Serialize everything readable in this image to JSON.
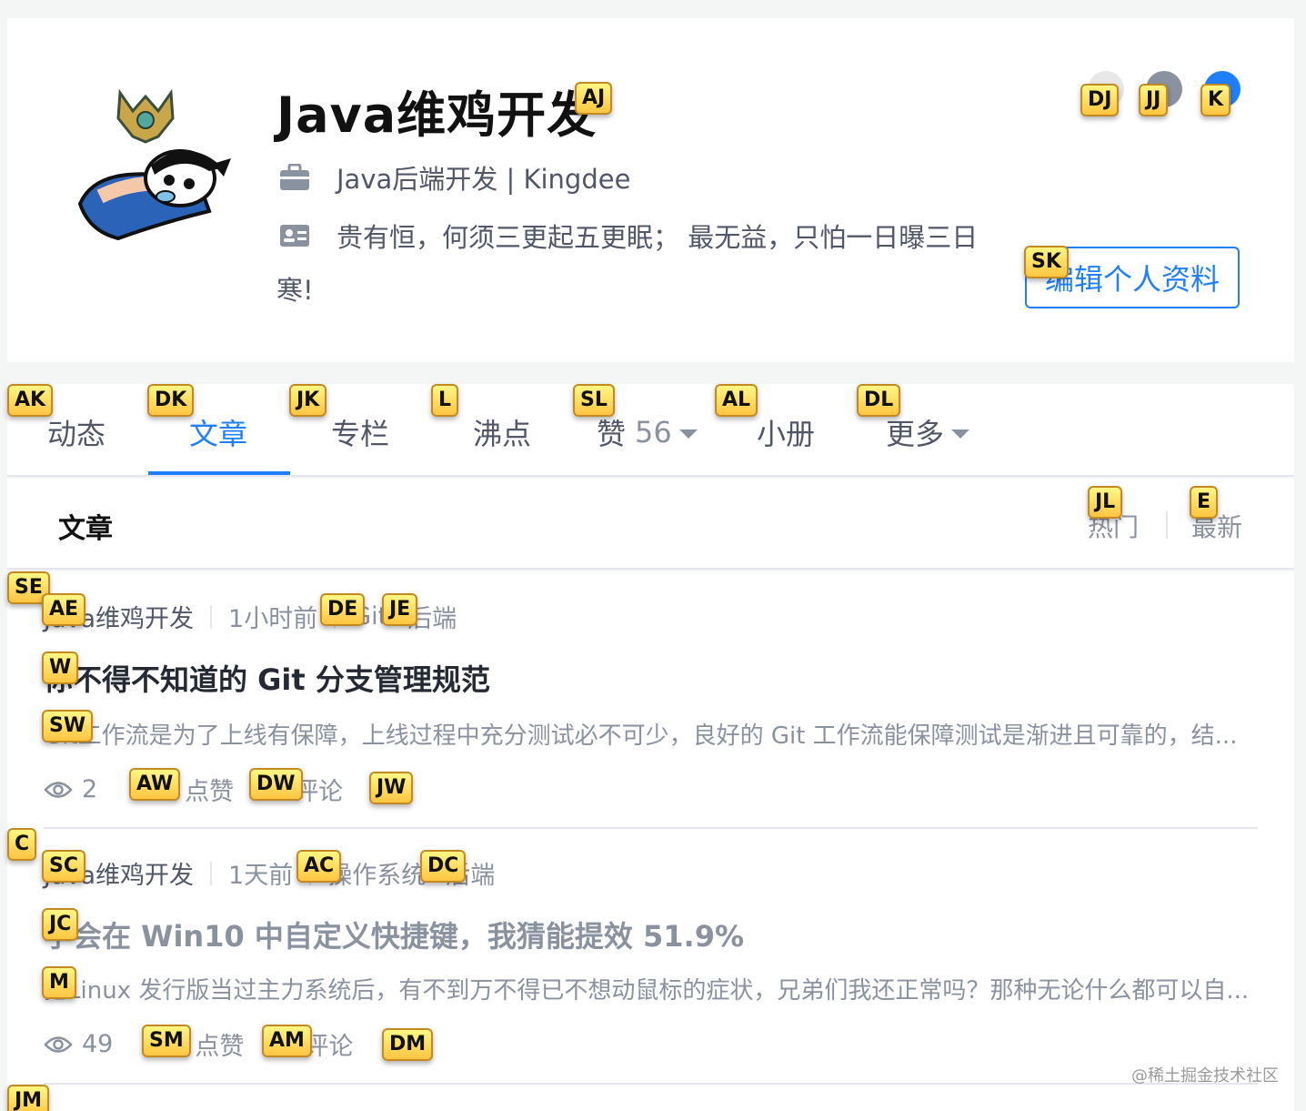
{
  "profile": {
    "name": "Java维鸡开发",
    "job": "Java后端开发 | Kingdee",
    "bio_line1": "贵有恒，何须三更起五更眠； 最无益，只怕一日曝三日",
    "bio_line2": "寒!",
    "edit_button": "编辑个人资料"
  },
  "tabs": [
    {
      "label": "动态"
    },
    {
      "label": "文章"
    },
    {
      "label": "专栏"
    },
    {
      "label": "沸点"
    },
    {
      "label": "赞",
      "count": "56"
    },
    {
      "label": "小册"
    },
    {
      "label": "更多"
    }
  ],
  "section": {
    "title": "文章",
    "sort_hot": "热门",
    "sort_new": "最新"
  },
  "articles": [
    {
      "author": "Java维鸡开发",
      "time": "1小时前",
      "tag1": "Git",
      "tag2": "后端",
      "title": "你不得不知道的 Git 分支管理规范",
      "abstract": "Git工作流是为了上线有保障，上线过程中充分测试必不可少，良好的 Git 工作流能保障测试是渐进且可靠的，结...",
      "views": "2",
      "like": "点赞",
      "comment": "评论"
    },
    {
      "author": "Java维鸡开发",
      "time": "1天前",
      "tag1": "操作系统",
      "tag2": "后端",
      "title": "学会在 Win10 中自定义快捷键，我猜能提效 51.9%",
      "abstract": "把Linux 发行版当过主力系统后，有不到万不得已不想动鼠标的症状，兄弟们我还正常吗？那种无论什么都可以自...",
      "views": "49",
      "like": "点赞",
      "comment": "评论"
    }
  ],
  "hints": {
    "name": "AJ",
    "social1": "DJ",
    "social2": "JJ",
    "social3": "K",
    "edit": "SK",
    "tab0": "AK",
    "tab1": "DK",
    "tab2": "JK",
    "tab3": "L",
    "tab4": "SL",
    "tab5": "AL",
    "tab6": "DL",
    "hot": "JL",
    "new": "E",
    "a1_row": "SE",
    "a1_author": "AE",
    "a1_tag1": "DE",
    "a1_tag2": "JE",
    "a1_title": "W",
    "a1_abstract": "SW",
    "a1_like": "AW",
    "a1_comment": "DW",
    "a1_more": "JW",
    "a2_row": "C",
    "a2_author": "SC",
    "a2_tag1": "AC",
    "a2_tag2": "DC",
    "a2_title": "JC",
    "a2_abstract": "M",
    "a2_like": "SM",
    "a2_comment": "AM",
    "a2_more": "DM",
    "a3_row": "JM"
  },
  "watermark": "@稀土掘金技术社区",
  "colors": {
    "accent": "#1e80ff",
    "hint_bg": "#ffd84a"
  }
}
